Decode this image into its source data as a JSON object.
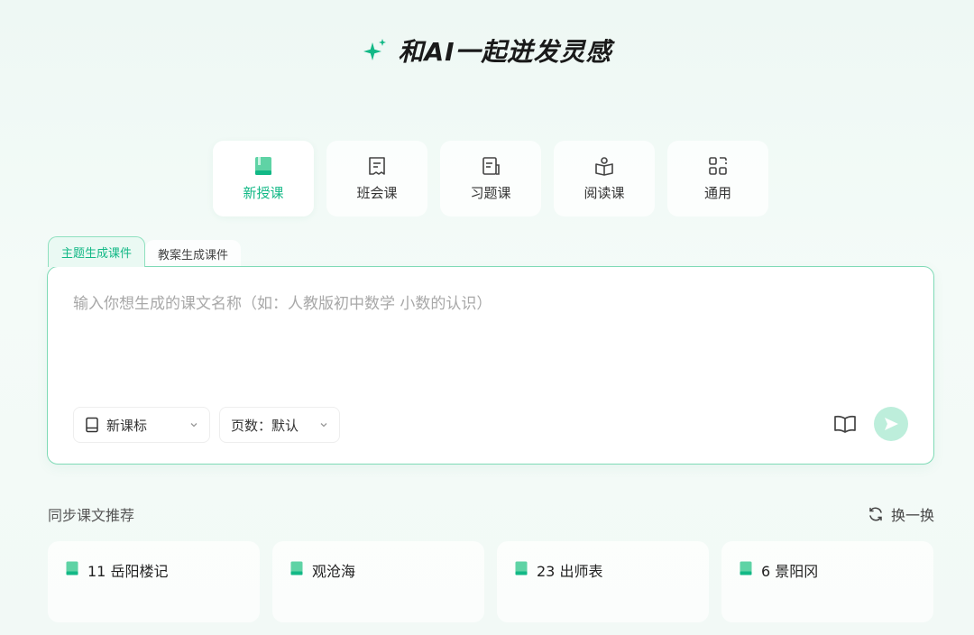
{
  "hero": {
    "title": "和AI一起迸发灵感",
    "icon": "sparkle-icon"
  },
  "lesson_types": [
    {
      "label": "新授课",
      "icon": "green-book-icon",
      "active": true
    },
    {
      "label": "班会课",
      "icon": "document-icon",
      "active": false
    },
    {
      "label": "习题课",
      "icon": "exercise-doc-icon",
      "active": false
    },
    {
      "label": "阅读课",
      "icon": "reading-icon",
      "active": false
    },
    {
      "label": "通用",
      "icon": "apps-grid-icon",
      "active": false
    }
  ],
  "tabs": [
    {
      "label": "主题生成课件",
      "active": true
    },
    {
      "label": "教案生成课件",
      "active": false
    }
  ],
  "input": {
    "placeholder": "输入你想生成的课文名称（如：人教版初中数学 小数的认识）",
    "value": ""
  },
  "selects": {
    "curriculum": "新课标",
    "pages": "页数：默认"
  },
  "recommend": {
    "title": "同步课文推荐",
    "refresh_label": "换一换",
    "items": [
      "11 岳阳楼记",
      "观沧海",
      "23 出师表",
      "6 景阳冈"
    ]
  },
  "colors": {
    "accent": "#12b886",
    "send_bg": "#bdeedb",
    "border": "#7fdab6"
  }
}
